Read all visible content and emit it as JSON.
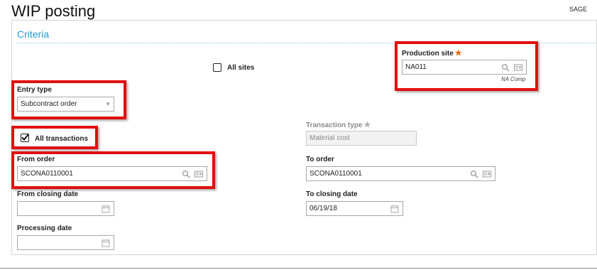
{
  "header": {
    "title": "WIP posting",
    "brand": "SAGE"
  },
  "panel": {
    "title": "Criteria"
  },
  "all_sites": {
    "label": "All sites",
    "checked": false
  },
  "production_site": {
    "label": "Production site",
    "required_mark": "★",
    "value": "NA011",
    "description": "NA Comp"
  },
  "entry_type": {
    "label": "Entry type",
    "value": "Subcontract order"
  },
  "all_transactions": {
    "label": "All transactions",
    "checked": true
  },
  "transaction_type": {
    "label": "Transaction type",
    "required_mark": "★",
    "value": "Material cost"
  },
  "from_order": {
    "label": "From order",
    "value": "SCONA0110001"
  },
  "to_order": {
    "label": "To order",
    "value": "SCONA0110001"
  },
  "from_closing_date": {
    "label": "From closing date",
    "value": ""
  },
  "to_closing_date": {
    "label": "To closing date",
    "value": "06/19/18"
  },
  "processing_date": {
    "label": "Processing date",
    "value": ""
  },
  "colors": {
    "accent": "#1aa0d8",
    "highlight": "#e01010",
    "required": "#e8660c"
  }
}
